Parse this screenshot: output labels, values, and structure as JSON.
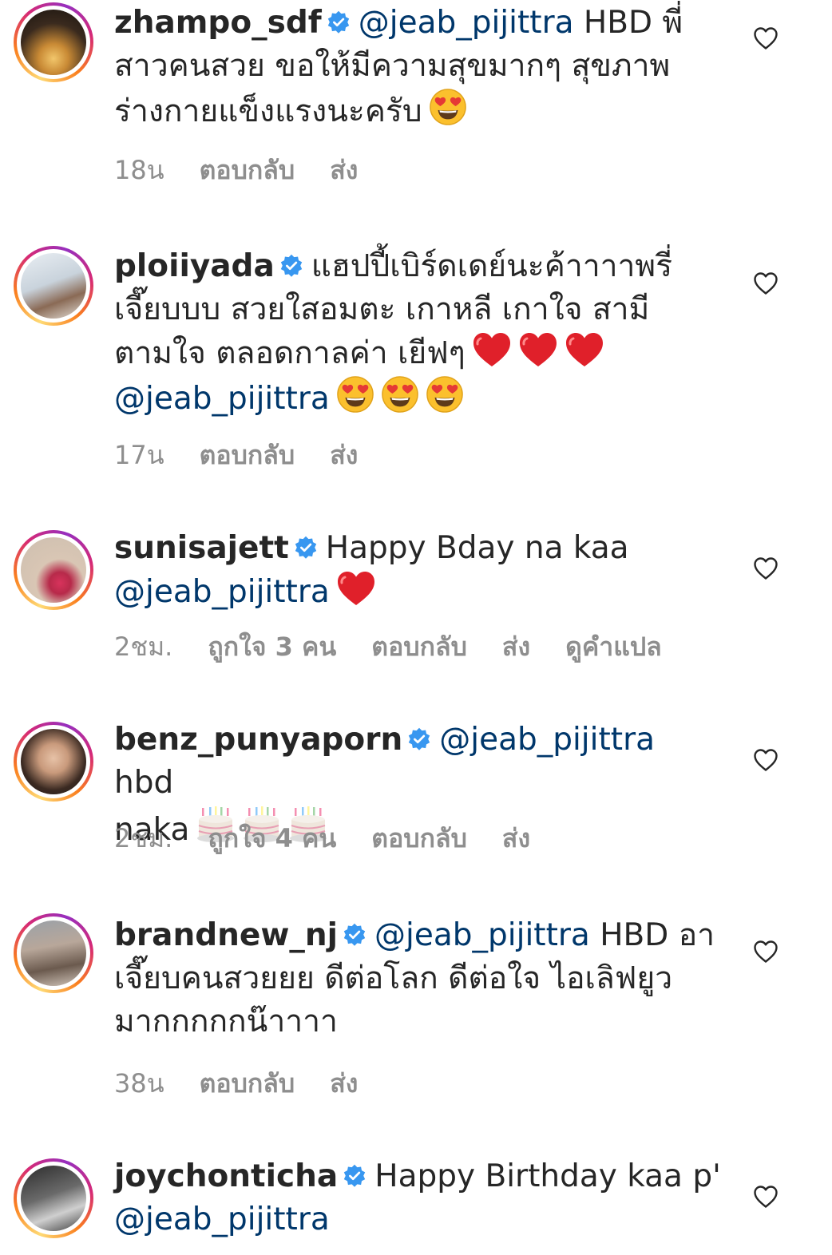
{
  "comments": [
    {
      "username": "zhampo_sdf",
      "mention": "@jeab_pijittra",
      "text_after_mention_line1": " HBD พี่",
      "text_line2": "สาวคนสวย ขอให้มีความสุขมากๆ สุขภาพ",
      "text_line3": "ร่างกายแข็งแรงนะครับ",
      "time": "18น",
      "reply": "ตอบกลับ",
      "send": "ส่ง"
    },
    {
      "username": "ploiiyada",
      "text_line1": "แฮปปี้เบิร์ดเดย์นะค้าาาาพรี่",
      "text_line2": "เจี๊ยบบบ  สวยใสอมตะ เกาหลี เกาใจ สามี",
      "text_line3": "ตามใจ ตลอดกาลค่า เยีฟๆ",
      "mention": "@jeab_pijittra",
      "time": "17น",
      "reply": "ตอบกลับ",
      "send": "ส่ง"
    },
    {
      "username": "sunisajett",
      "text_line1": "Happy Bday na kaa",
      "mention": "@jeab_pijittra",
      "time": "2ชม.",
      "likes": "ถูกใจ 3 คน",
      "reply": "ตอบกลับ",
      "send": "ส่ง",
      "translate": "ดูคำแปล"
    },
    {
      "username": "benz_punyaporn",
      "mention": "@jeab_pijittra",
      "text_after_mention": " hbd",
      "text_line2": "naka",
      "time": "2ชม.",
      "likes": "ถูกใจ 4 คน",
      "reply": "ตอบกลับ",
      "send": "ส่ง"
    },
    {
      "username": "brandnew_nj",
      "mention": "@jeab_pijittra",
      "text_after_mention": " HBD อา",
      "text_line2": "เจี๊ยบคนสวยยย ดีต่อโลก ดีต่อใจ ไอเลิฟยูว",
      "text_line3": "มากกกกกน๊าาาา",
      "time": "38น",
      "reply": "ตอบกลับ",
      "send": "ส่ง"
    },
    {
      "username": "joychonticha",
      "text_line1": "Happy Birthday kaa p'",
      "mention": "@jeab_pijittra"
    }
  ],
  "icons": {
    "verified": "verified-badge-icon",
    "heart": "heart-outline-icon",
    "heart_eyes": "heart-eyes-emoji",
    "red_heart": "red-heart-emoji",
    "cake": "birthday-cake-emoji"
  },
  "colors": {
    "verified_blue": "#3897f0",
    "mention": "#00376b",
    "meta_gray": "#8e8e8e"
  }
}
